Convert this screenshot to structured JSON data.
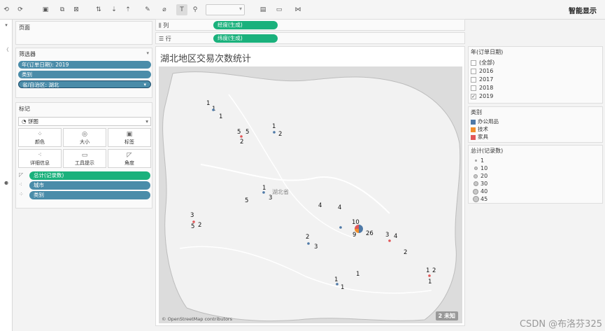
{
  "toolbar": {
    "smart_show": "智能显示"
  },
  "sidebar_strip": {
    "rows": [
      "",
      "▾",
      "〈",
      "⚈",
      "",
      "",
      "",
      "",
      ""
    ]
  },
  "pages_card": {
    "title": "页面"
  },
  "filters_card": {
    "title": "筛选器",
    "items": [
      "年(订单日期): 2019",
      "类别",
      "省/自治区: 湖北"
    ]
  },
  "marks_card": {
    "title": "标记",
    "mark_type": "饼图",
    "buttons": [
      "颜色",
      "大小",
      "标签",
      "详细信息",
      "工具提示",
      "角度"
    ],
    "fields": [
      {
        "icon": "angle-icon",
        "label": "总计(记录数)",
        "color": "green"
      },
      {
        "icon": "detail-icon",
        "label": "城市",
        "color": "blue"
      },
      {
        "icon": "color-icon",
        "label": "类别",
        "color": "blue"
      }
    ]
  },
  "shelves": {
    "columns": {
      "label": "列",
      "pill": "经度(生成)"
    },
    "rows": {
      "label": "行",
      "pill": "纬度(生成)"
    }
  },
  "viz": {
    "title": "湖北地区交易次数统计",
    "province_label": "湖北省",
    "map_credit": "© OpenStreetMap contributors",
    "unknown_badge": "2 未知"
  },
  "chart_data": {
    "type": "pie",
    "title": "湖北地区交易次数统计",
    "size_by": "总计(记录数)",
    "color_by": "类别",
    "data_labels": [
      "1",
      "1",
      "1",
      "5",
      "5",
      "2",
      "1",
      "2",
      "1",
      "3",
      "5",
      "4",
      "4",
      "3",
      "2",
      "5",
      "10",
      "9",
      "26",
      "2",
      "3",
      "3",
      "4",
      "2",
      "1",
      "1",
      "1",
      "1",
      "2",
      "1"
    ],
    "colors": {
      "办公用品": "#4e79a7",
      "技术": "#f28e2b",
      "家具": "#e15759"
    }
  },
  "year_filter": {
    "title": "年(订单日期)",
    "options": [
      {
        "label": "(全部)",
        "checked": false
      },
      {
        "label": "2016",
        "checked": false
      },
      {
        "label": "2017",
        "checked": false
      },
      {
        "label": "2018",
        "checked": false
      },
      {
        "label": "2019",
        "checked": true
      }
    ]
  },
  "category_legend": {
    "title": "类别",
    "items": [
      {
        "label": "办公用品",
        "color": "#4e79a7"
      },
      {
        "label": "技术",
        "color": "#f28e2b"
      },
      {
        "label": "家具",
        "color": "#e15759"
      }
    ]
  },
  "size_legend": {
    "title": "总计(记录数)",
    "items": [
      "1",
      "10",
      "20",
      "30",
      "40",
      "45"
    ]
  },
  "watermark": "CSDN @布洛芬325"
}
